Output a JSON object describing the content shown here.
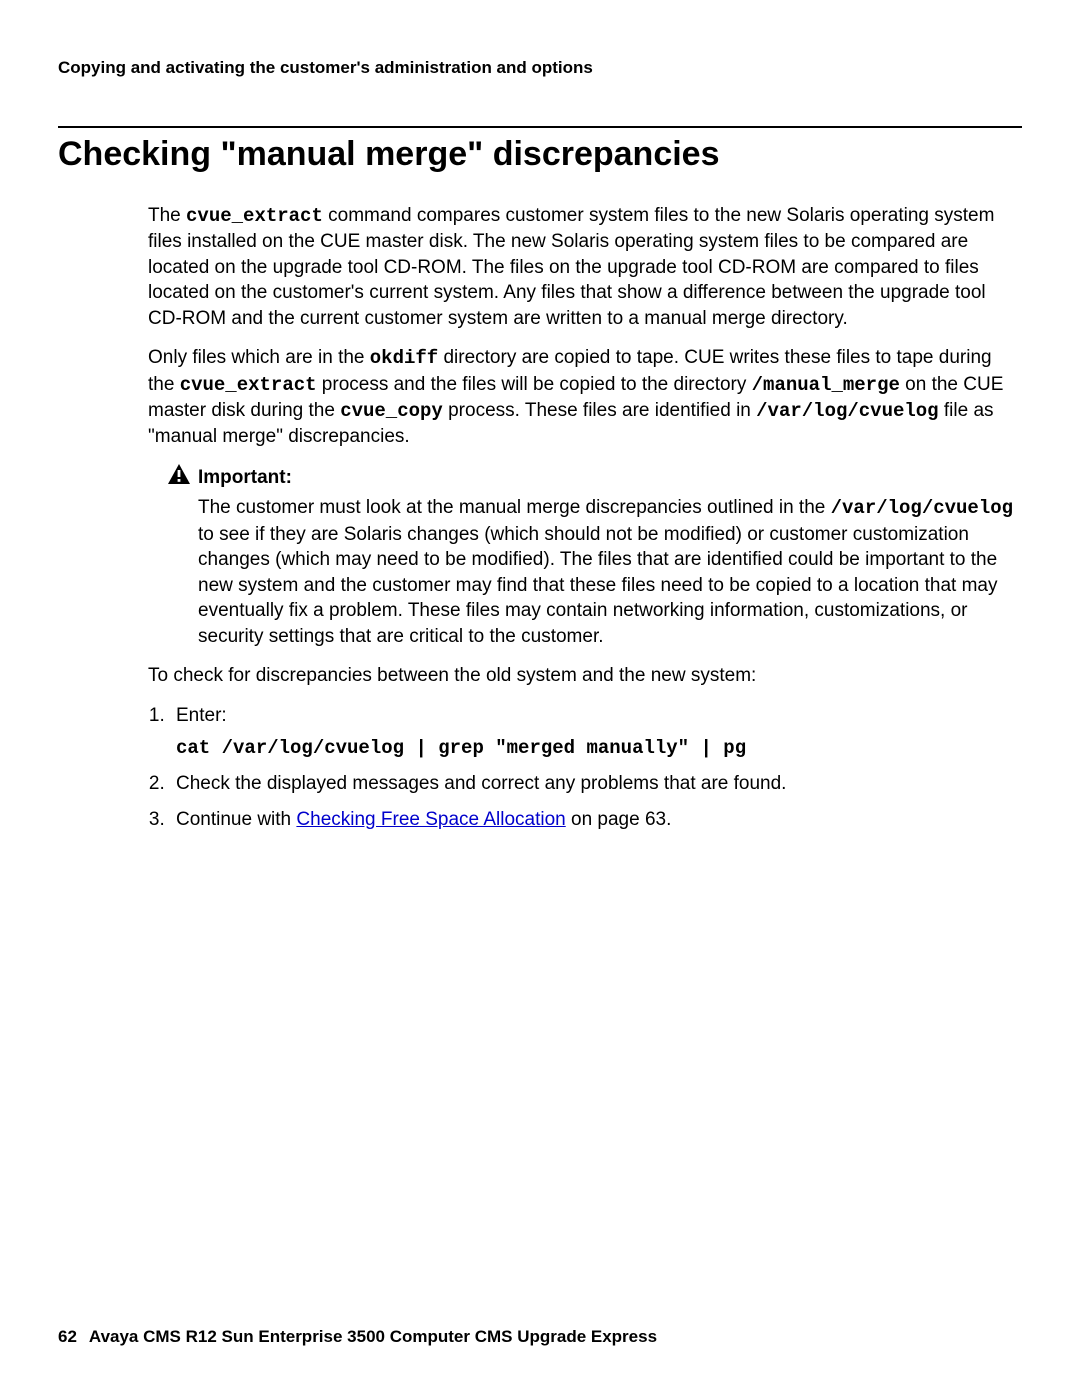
{
  "header": {
    "running": "Copying and activating the customer's administration and options"
  },
  "section": {
    "title": "Checking \"manual merge\" discrepancies"
  },
  "para1": {
    "t1": "The ",
    "c1": "cvue_extract",
    "t2": " command compares customer system files to the new Solaris operating system files installed on the CUE master disk. The new Solaris operating system files to be compared are located on the upgrade tool CD-ROM. The files on the upgrade tool CD-ROM are compared to files located on the customer's current system. Any files that show a difference between the upgrade tool CD-ROM and the current customer system are written to a manual merge directory."
  },
  "para2": {
    "t1": "Only files which are in the ",
    "c1": "okdiff",
    "t2": " directory are copied to tape. CUE writes these files to tape during the ",
    "c2": "cvue_extract",
    "t3": " process and the files will be copied to the directory ",
    "c3": "/manual_merge",
    "t4": " on the CUE master disk during the ",
    "c4": "cvue_copy",
    "t5": " process. These files are identified in ",
    "c5": "/var/log/cvuelog",
    "t6": " file as \"manual merge\" discrepancies."
  },
  "important": {
    "label": "Important:",
    "t1": "The customer must look at the manual merge discrepancies outlined in the ",
    "c1": "/var/log/cvuelog",
    "t2": " to see if they are Solaris changes (which should not be modified) or customer customization changes (which may need to be modified). The files that are identified could be important to the new system and the customer may find that these files need to be copied to a location that may eventually fix a problem. These files may contain networking information, customizations, or security settings that are critical to the customer."
  },
  "lead": "To check for discrepancies between the old system and the new system:",
  "steps": {
    "s1a": "Enter:",
    "s1cmd": "cat /var/log/cvuelog | grep \"merged manually\" | pg",
    "s2": "Check the displayed messages and correct any problems that are found.",
    "s3a": "Continue with ",
    "s3link": "Checking Free Space Allocation",
    "s3b": " on page 63."
  },
  "footer": {
    "page": "62",
    "title": "Avaya CMS R12 Sun Enterprise 3500 Computer CMS Upgrade Express"
  }
}
